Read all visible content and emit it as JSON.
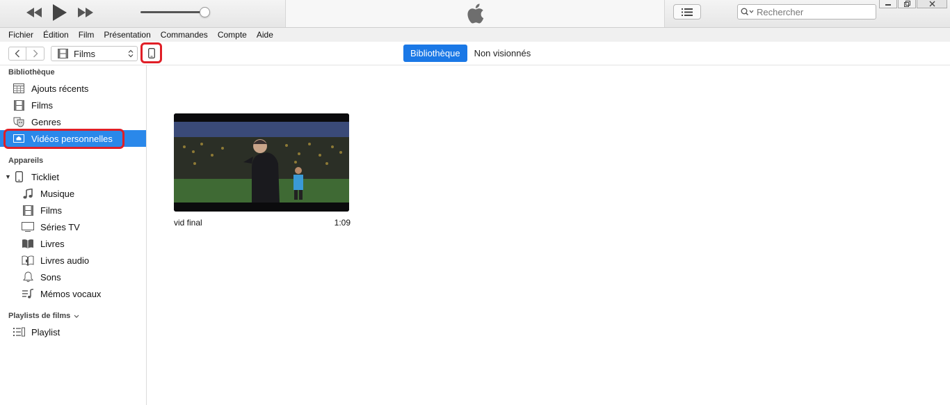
{
  "player": {
    "search_placeholder": "Rechercher"
  },
  "menu": [
    "Fichier",
    "Édition",
    "Film",
    "Présentation",
    "Commandes",
    "Compte",
    "Aide"
  ],
  "toolbar": {
    "media_type": "Films",
    "tabs": [
      {
        "label": "Bibliothèque",
        "active": true
      },
      {
        "label": "Non visionnés",
        "active": false
      }
    ]
  },
  "sidebar": {
    "library_header": "Bibliothèque",
    "library_items": [
      {
        "label": "Ajouts récents",
        "icon": "grid-icon"
      },
      {
        "label": "Films",
        "icon": "film-icon"
      },
      {
        "label": "Genres",
        "icon": "masks-icon"
      },
      {
        "label": "Vidéos personnelles",
        "icon": "home-video-icon",
        "selected": true
      }
    ],
    "devices_header": "Appareils",
    "device_name": "Tickliet",
    "device_items": [
      {
        "label": "Musique",
        "icon": "music-note-icon"
      },
      {
        "label": "Films",
        "icon": "film-icon"
      },
      {
        "label": "Séries TV",
        "icon": "tv-icon"
      },
      {
        "label": "Livres",
        "icon": "book-icon"
      },
      {
        "label": "Livres audio",
        "icon": "audiobook-icon"
      },
      {
        "label": "Sons",
        "icon": "bell-icon"
      },
      {
        "label": "Mémos vocaux",
        "icon": "voice-memo-icon"
      }
    ],
    "playlists_header": "Playlists de films",
    "playlist_items": [
      {
        "label": "Playlist",
        "icon": "playlist-icon"
      }
    ]
  },
  "content": {
    "videos": [
      {
        "title": "vid final",
        "duration": "1:09"
      }
    ]
  },
  "colors": {
    "accent": "#1a78e6",
    "selection": "#2a88ea",
    "annotation_red": "#e01f27"
  }
}
